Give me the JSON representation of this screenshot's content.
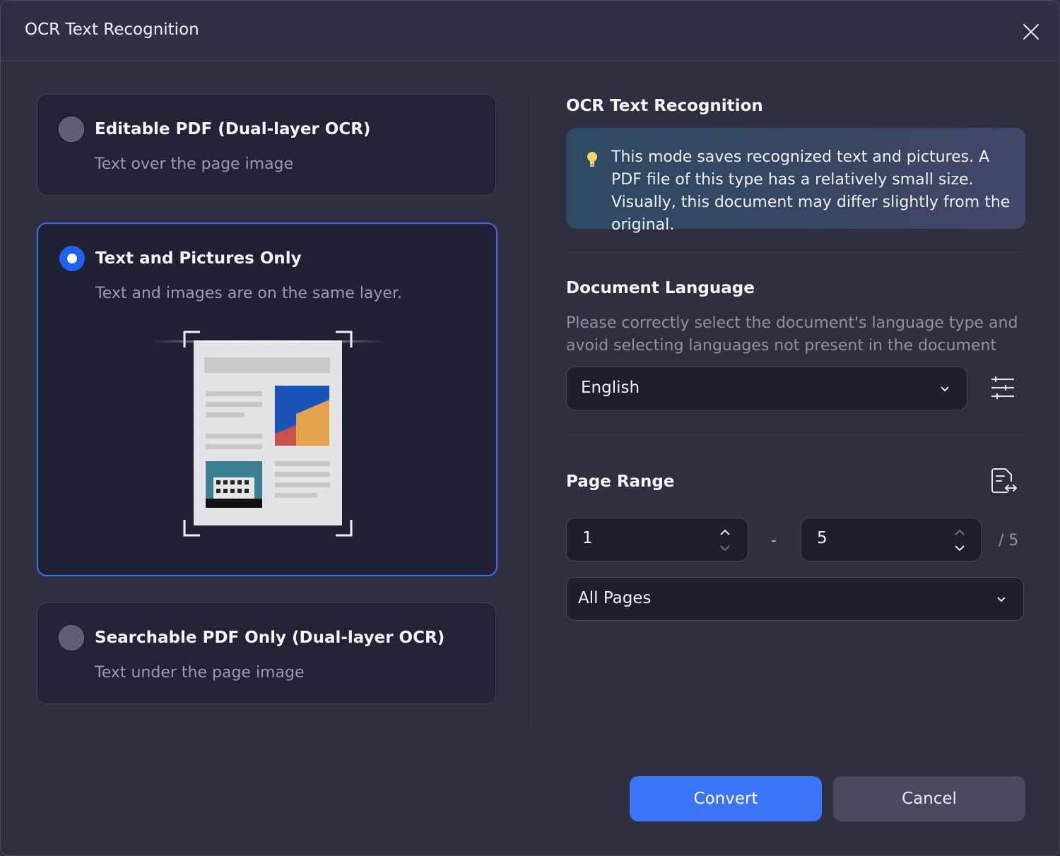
{
  "window": {
    "title": "OCR Text Recognition"
  },
  "modes": [
    {
      "title": "Editable PDF (Dual-layer OCR)",
      "description": "Text over the page image",
      "selected": false
    },
    {
      "title": "Text and Pictures Only",
      "description": "Text and images are on the same layer.",
      "selected": true
    },
    {
      "title": "Searchable PDF Only (Dual-layer OCR)",
      "description": "Text under the page image",
      "selected": false
    }
  ],
  "ocr_section": {
    "title": "OCR Text Recognition",
    "info_text": "This mode saves recognized text and pictures. A PDF file of this type has a relatively small size. Visually, this document may differ slightly from the original."
  },
  "language_section": {
    "title": "Document Language",
    "description": "Please correctly select the document's language type and avoid selecting languages not present in the document",
    "selected_language": "English"
  },
  "page_range": {
    "title": "Page Range",
    "from": "1",
    "separator": "-",
    "to": "5",
    "total": "/ 5",
    "subset": "All Pages"
  },
  "buttons": {
    "convert": "Convert",
    "cancel": "Cancel"
  },
  "colors": {
    "accent": "#3b74f6",
    "selected_border": "#3b6cf5",
    "background": "#2e2f3f"
  }
}
